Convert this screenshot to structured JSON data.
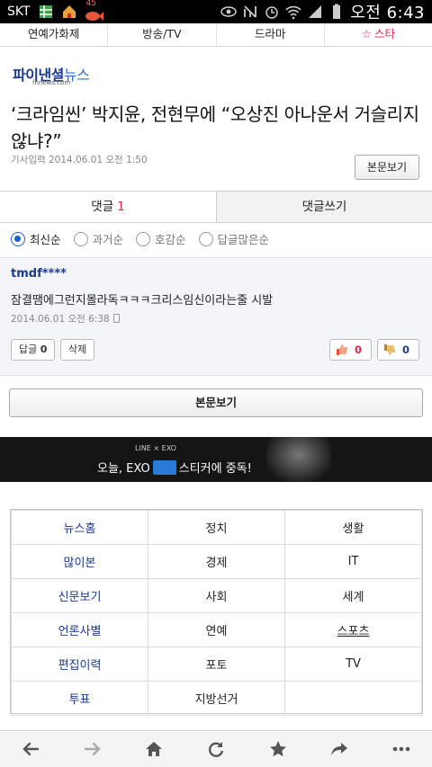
{
  "status": {
    "carrier": "SKT",
    "notif_count": "45",
    "clock": "오전 6:43"
  },
  "categories": [
    "연예가화제",
    "방송/TV",
    "드라마",
    "스타"
  ],
  "logo": {
    "main": "파이낸셜",
    "sub": "뉴스",
    "url": "fnnews.com"
  },
  "article": {
    "title": "‘크라임씬’ 박지윤, 전현무에 “오상진 아나운서 거슬리지 않냐?”",
    "meta": "기사입력  2014.06.01 오전 1:50",
    "view_button": "본문보기"
  },
  "comment_tabs": {
    "comments_label": "댓글",
    "comments_count": "1",
    "write_label": "댓글쓰기"
  },
  "sort_options": [
    "최신순",
    "과거순",
    "호감순",
    "답글많은순"
  ],
  "comment": {
    "user": "tmdf****",
    "text": "잠결땜에그런지몰라독ㅋㅋㅋ크리스임신이라는줄 시발",
    "date": "2014.06.01 오전 6:38",
    "reply_label": "답글",
    "reply_count": "0",
    "delete_label": "삭제",
    "likes": "0",
    "dislikes": "0"
  },
  "view_article_button": "본문보기",
  "ad": {
    "brand": "LINE × EXO",
    "message_pre": "오늘, EXO",
    "message_post": "스티커에 중독!"
  },
  "menu_grid": [
    [
      "뉴스홈",
      "정치",
      "생활"
    ],
    [
      "많이본",
      "경제",
      "IT"
    ],
    [
      "신문보기",
      "사회",
      "세계"
    ],
    [
      "언론사별",
      "연예",
      "스포츠"
    ],
    [
      "편집이력",
      "포토",
      "TV"
    ],
    [
      "투표",
      "지방선거",
      ""
    ]
  ],
  "bottom_nav": [
    "back-icon",
    "forward-icon",
    "home-icon",
    "refresh-icon",
    "bookmark-icon",
    "share-icon",
    "more-icon"
  ]
}
